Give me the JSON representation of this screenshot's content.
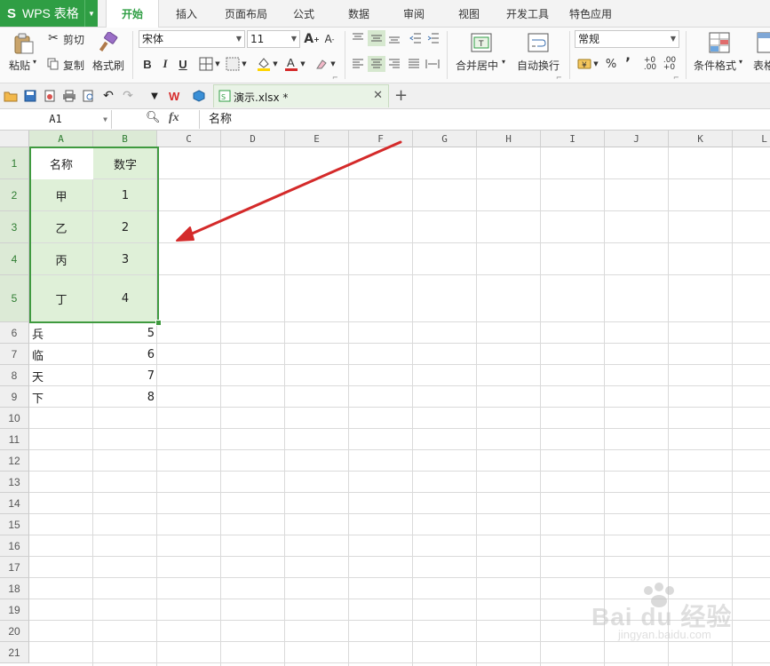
{
  "app": {
    "name": "WPS 表格"
  },
  "menu_tabs": [
    "开始",
    "插入",
    "页面布局",
    "公式",
    "数据",
    "审阅",
    "视图",
    "开发工具",
    "特色应用"
  ],
  "active_tab": "开始",
  "ribbon": {
    "paste": "粘贴",
    "cut": "剪切",
    "copy": "复制",
    "format_painter": "格式刷",
    "font_name": "宋体",
    "font_size": "11",
    "bold": "B",
    "italic": "I",
    "underline": "U",
    "merge_center": "合并居中",
    "wrap_text": "自动换行",
    "number_format": "常规",
    "percent": "%",
    "thousands": "’",
    "conditional_format": "条件格式",
    "table_style": "表格"
  },
  "doc_tab": {
    "name": "演示.xlsx *"
  },
  "formula_bar": {
    "name_box": "A1",
    "fx_label": "fx",
    "content": "名称"
  },
  "columns": [
    "A",
    "B",
    "C",
    "D",
    "E",
    "F",
    "G",
    "H",
    "I",
    "J",
    "K",
    "L"
  ],
  "rows": [
    "1",
    "2",
    "3",
    "4",
    "5",
    "6",
    "7",
    "8",
    "9",
    "10",
    "11",
    "12",
    "13",
    "14",
    "15",
    "16",
    "17",
    "18",
    "19",
    "20",
    "21"
  ],
  "cells": {
    "A1": "名称",
    "B1": "数字",
    "A2": "甲",
    "B2": "1",
    "A3": "乙",
    "B3": "2",
    "A4": "丙",
    "B4": "3",
    "A5": "丁",
    "B5": "4",
    "A6": "兵",
    "B6": "5",
    "A7": "临",
    "B7": "6",
    "A8": "天",
    "B8": "7",
    "A9": "下",
    "B9": "8"
  },
  "selection": "A1:B5",
  "colors": {
    "accent": "#2f9e44",
    "selection_fill": "#dff0d8",
    "selection_border": "#3f9a3f",
    "arrow": "#d42a2a"
  },
  "watermark": {
    "logo": "Bai du 经验",
    "url": "jingyan.baidu.com"
  }
}
